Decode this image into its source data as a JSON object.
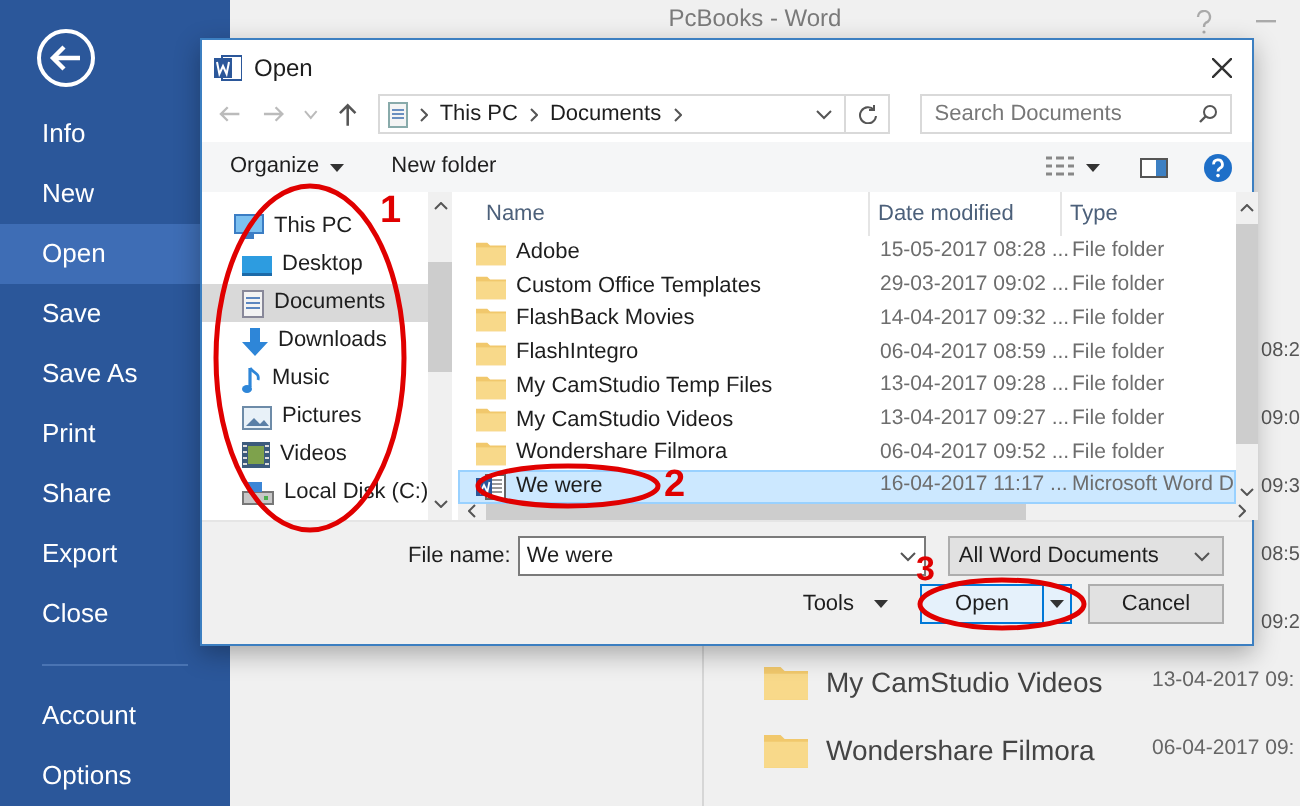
{
  "app_title": "PcBooks - Word",
  "backstage": {
    "items": [
      {
        "label": "Info",
        "selected": false
      },
      {
        "label": "New",
        "selected": false
      },
      {
        "label": "Open",
        "selected": true
      },
      {
        "label": "Save",
        "selected": false
      },
      {
        "label": "Save As",
        "selected": false
      },
      {
        "label": "Print",
        "selected": false
      },
      {
        "label": "Share",
        "selected": false
      },
      {
        "label": "Export",
        "selected": false
      },
      {
        "label": "Close",
        "selected": false
      }
    ],
    "footer_items": [
      {
        "label": "Account",
        "selected": false
      },
      {
        "label": "Options",
        "selected": false
      }
    ]
  },
  "background_dates_cut": [
    "08:2",
    "09:0",
    "09:3",
    "08:5",
    "09:2"
  ],
  "background_list": [
    {
      "name": "My CamStudio Videos",
      "date": "13-04-2017 09:"
    },
    {
      "name": "Wondershare Filmora",
      "date": "06-04-2017 09:"
    }
  ],
  "dialog": {
    "title": "Open",
    "breadcrumb": [
      "This PC",
      "Documents"
    ],
    "search_placeholder": "Search Documents",
    "toolbar": {
      "organize": "Organize",
      "new_folder": "New folder"
    },
    "nav_items": [
      {
        "label": "This PC",
        "kind": "pc",
        "selected": false
      },
      {
        "label": "Desktop",
        "kind": "desktop",
        "selected": false
      },
      {
        "label": "Documents",
        "kind": "documents",
        "selected": true
      },
      {
        "label": "Downloads",
        "kind": "downloads",
        "selected": false
      },
      {
        "label": "Music",
        "kind": "music",
        "selected": false
      },
      {
        "label": "Pictures",
        "kind": "pictures",
        "selected": false
      },
      {
        "label": "Videos",
        "kind": "videos",
        "selected": false
      },
      {
        "label": "Local Disk (C:)",
        "kind": "disk",
        "selected": false
      }
    ],
    "columns": [
      "Name",
      "Date modified",
      "Type"
    ],
    "files": [
      {
        "name": "Adobe",
        "date": "15-05-2017 08:28 ...",
        "type": "File folder",
        "kind": "folder",
        "selected": false
      },
      {
        "name": "Custom Office Templates",
        "date": "29-03-2017 09:02 ...",
        "type": "File folder",
        "kind": "folder",
        "selected": false
      },
      {
        "name": "FlashBack Movies",
        "date": "14-04-2017 09:32 ...",
        "type": "File folder",
        "kind": "folder",
        "selected": false
      },
      {
        "name": "FlashIntegro",
        "date": "06-04-2017 08:59 ...",
        "type": "File folder",
        "kind": "folder",
        "selected": false
      },
      {
        "name": "My CamStudio Temp Files",
        "date": "13-04-2017 09:28 ...",
        "type": "File folder",
        "kind": "folder",
        "selected": false
      },
      {
        "name": "My CamStudio Videos",
        "date": "13-04-2017 09:27 ...",
        "type": "File folder",
        "kind": "folder",
        "selected": false
      },
      {
        "name": "Wondershare Filmora",
        "date": "06-04-2017 09:52 ...",
        "type": "File folder",
        "kind": "folder",
        "selected": false
      },
      {
        "name": "We were",
        "date": "16-04-2017 11:17 ...",
        "type": "Microsoft Word D",
        "kind": "word",
        "selected": true
      }
    ],
    "file_name_label": "File name:",
    "file_name_value": "We were",
    "filter": "All Word Documents",
    "tools": "Tools",
    "open_button": "Open",
    "cancel_button": "Cancel"
  },
  "annotations": [
    {
      "number": "1"
    },
    {
      "number": "2"
    },
    {
      "number": "3"
    }
  ]
}
